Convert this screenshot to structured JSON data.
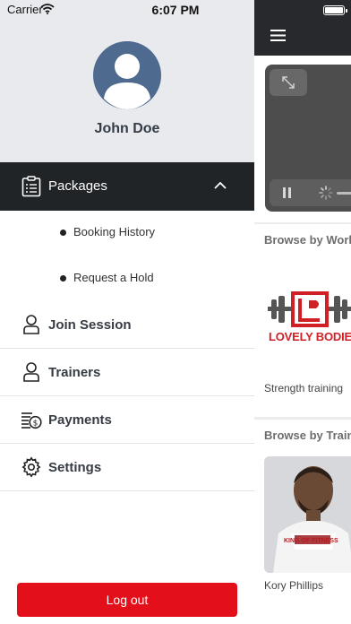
{
  "status_bar": {
    "carrier": "Carrier",
    "time": "6:07 PM",
    "battery_level": 1.0
  },
  "drawer": {
    "profile": {
      "name": "John Doe",
      "avatar_icon": "user-circle-icon",
      "avatar_color": "#4e6a8f"
    },
    "packages": {
      "label": "Packages",
      "icon": "clipboard-list-icon",
      "expanded": true,
      "sub_items": [
        {
          "label": "Booking History"
        },
        {
          "label": "Request a Hold"
        }
      ]
    },
    "menu_items": [
      {
        "label": "Join Session",
        "icon": "person-icon"
      },
      {
        "label": "Trainers",
        "icon": "person-icon"
      },
      {
        "label": "Payments",
        "icon": "money-stack-icon"
      },
      {
        "label": "Settings",
        "icon": "gear-icon"
      }
    ],
    "logout_label": "Log out"
  },
  "main": {
    "menu_icon": "hamburger-icon",
    "video": {
      "fullscreen_icon": "expand-icon",
      "pause_icon": "pause-icon",
      "loading_icon": "spinner-icon"
    },
    "browse_workouts": {
      "title": "Browse by Work",
      "card_logo_text": "LOVELY BODIES",
      "card_caption": "Strength training"
    },
    "browse_trainers": {
      "title": "Browse by Train",
      "shirt_text": "KING OF FITNESS",
      "card_caption": "Kory Phillips"
    }
  },
  "colors": {
    "drawer_header_bg": "#e9eaee",
    "active_row_bg": "#202427",
    "logout_button": "#e3101c",
    "app_header_bg": "#27292c",
    "brand_red": "#d11f26"
  }
}
